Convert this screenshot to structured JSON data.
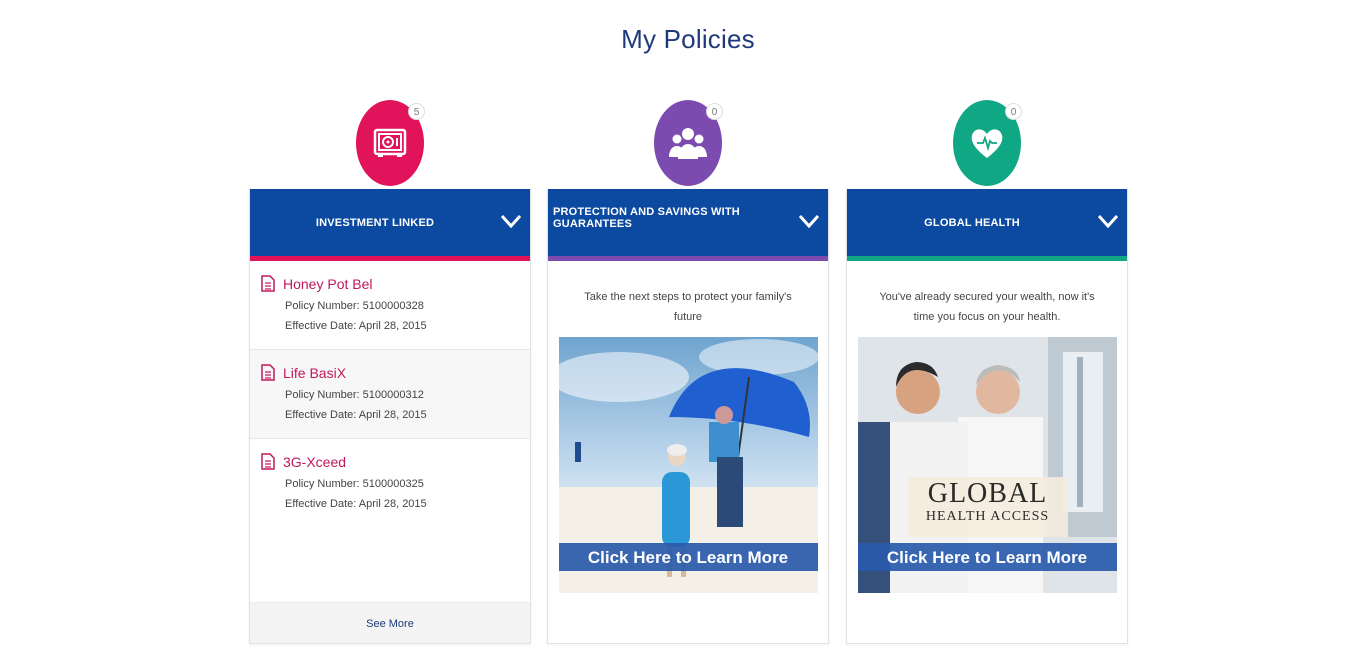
{
  "page": {
    "title": "My Policies"
  },
  "columns": [
    {
      "header": "INVESTMENT LINKED",
      "badge": "5",
      "icon": "safe-icon",
      "color": "#e0135b",
      "policies": [
        {
          "name": "Honey Pot Bel",
          "number": "Policy Number: 5100000328",
          "date": "Effective Date: April 28, 2015"
        },
        {
          "name": "Life BasiX",
          "number": "Policy Number: 5100000312",
          "date": "Effective Date: April 28, 2015"
        },
        {
          "name": "3G-Xceed",
          "number": "Policy Number: 5100000325",
          "date": "Effective Date: April 28, 2015"
        }
      ],
      "see_more": "See More"
    },
    {
      "header": "PROTECTION AND SAVINGS WITH GUARANTEES",
      "badge": "0",
      "icon": "family-icon",
      "color": "#7b4bb0",
      "text": "Take the next steps to protect your family's future",
      "cta": "Click Here to Learn More"
    },
    {
      "header": "GLOBAL HEALTH",
      "badge": "0",
      "icon": "heart-pulse-icon",
      "color": "#0fa784",
      "text": "You've already secured your wealth, now it's time you focus on your health.",
      "cta": "Click Here to Learn More",
      "logo_text": "GLOBAL",
      "logo_sub": "HEALTH ACCESS"
    }
  ],
  "colors": {
    "header_blue": "#0b4aa0",
    "title": "#1f3a7a",
    "policy_name": "#c2185b"
  }
}
